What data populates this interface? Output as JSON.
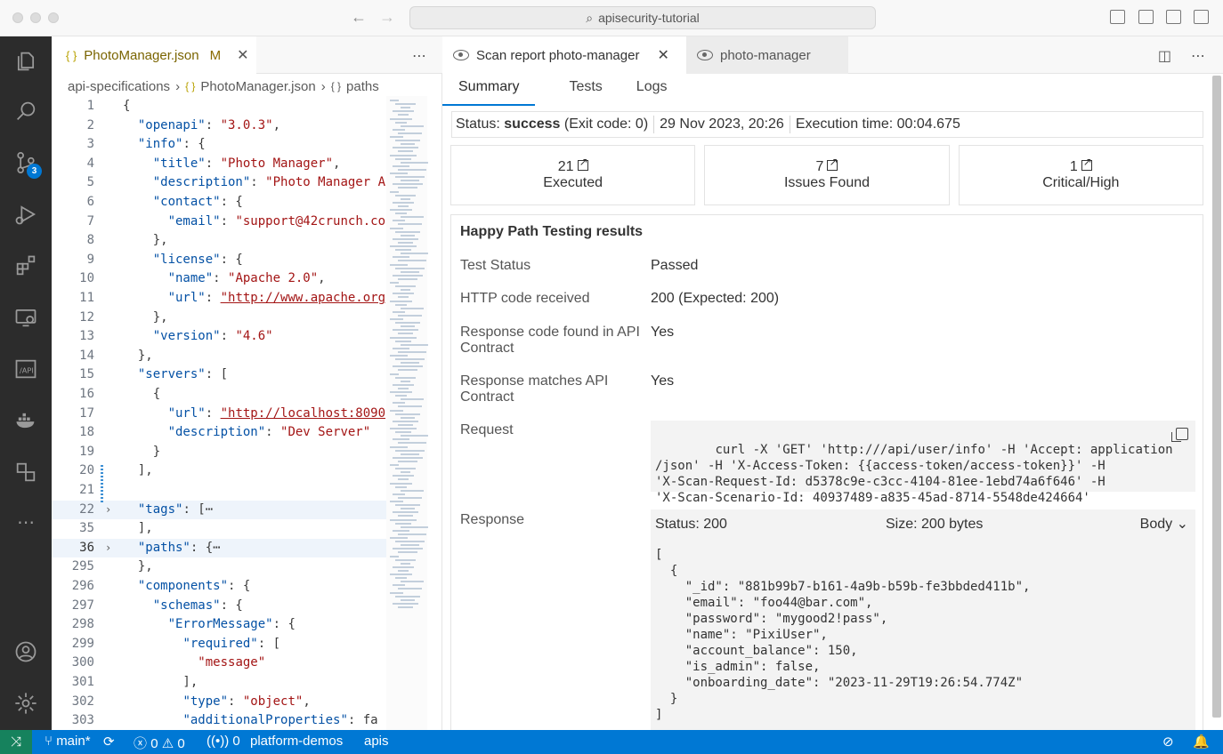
{
  "titlebar": {
    "search_text": "apisecurity-tutorial"
  },
  "activitybar": {
    "scm_badge": "3"
  },
  "editor": {
    "tab": {
      "name": "PhotoManager.json",
      "modified": "M"
    },
    "breadcrumb": [
      "api-specifications",
      "PhotoManager.json",
      "paths"
    ],
    "lines": [
      {
        "n": "1",
        "t": "{"
      },
      {
        "n": "2",
        "t": "  \"openapi\": \"3.0.3\","
      },
      {
        "n": "3",
        "t": "  \"info\": {"
      },
      {
        "n": "4",
        "t": "    \"title\": \"Photo Manager\","
      },
      {
        "n": "5",
        "t": "    \"description\": \"Photo Manager A"
      },
      {
        "n": "6",
        "t": "    \"contact\": {"
      },
      {
        "n": "7",
        "t": "      \"email\": \"support@42crunch.co"
      },
      {
        "n": "8",
        "t": "    },"
      },
      {
        "n": "9",
        "t": "    \"license\": {"
      },
      {
        "n": "10",
        "t": "      \"name\": \"Apache 2.0\","
      },
      {
        "n": "11",
        "t": "      \"url\": \"http://www.apache.org"
      },
      {
        "n": "12",
        "t": "    },"
      },
      {
        "n": "13",
        "t": "    \"version\": \"4.6\""
      },
      {
        "n": "14",
        "t": "  },"
      },
      {
        "n": "15",
        "t": "  \"servers\": ["
      },
      {
        "n": "16",
        "t": "    {"
      },
      {
        "n": "17",
        "t": "      \"url\": \"http://localhost:8090"
      },
      {
        "n": "18",
        "t": "      \"description\": \"Dev Server\""
      },
      {
        "n": "19",
        "t": "    }"
      },
      {
        "n": "20",
        "t": "  ],"
      },
      {
        "n": "21",
        "t": ""
      },
      {
        "n": "22",
        "t": "  \"tags\": [⋯"
      },
      {
        "n": "35",
        "t": "  ],"
      },
      {
        "n": "36",
        "t": "  \"paths\": {⋯"
      },
      {
        "n": "295",
        "t": "  },"
      },
      {
        "n": "296",
        "t": "  \"components\": {"
      },
      {
        "n": "297",
        "t": "    \"schemas\": {"
      },
      {
        "n": "298",
        "t": "      \"ErrorMessage\": {"
      },
      {
        "n": "299",
        "t": "        \"required\": ["
      },
      {
        "n": "300",
        "t": "          \"message\""
      },
      {
        "n": "301",
        "t": "        ],"
      },
      {
        "n": "302",
        "t": "        \"type\": \"object\","
      },
      {
        "n": "303",
        "t": "        \"additionalProperties\": fa"
      }
    ]
  },
  "panel": {
    "tab_active": "Scan report photo-manager",
    "tab_inactive": "photo-manager",
    "subtabs": [
      "Summary",
      "Tests",
      "Logs"
    ],
    "status": {
      "label": "Status:",
      "value": "success",
      "exit": "(Exit code: 0)",
      "date": "29 Nov 2023, 20:26",
      "exec": "Execution time: 00:04.675"
    },
    "stats": [
      {
        "num": "21",
        "label": "Executed"
      },
      {
        "num": "7",
        "label": "Issues Found"
      },
      {
        "num": "1",
        "label": "Critical/High"
      }
    ],
    "results_title": "Happy Path Testing results",
    "rows": [
      {
        "label": "Test Status",
        "value": "Passed"
      },
      {
        "label": "HTTP code received",
        "value": "200 (Expected: 200)"
      },
      {
        "label": "Response code found in API Contract",
        "value": "Yes"
      },
      {
        "label": "Response matches API Contract",
        "value": "Yes"
      }
    ],
    "request_label": "Request",
    "request_text": "curl -X 'GET' 'http:///api/user/info' -H 'Accept: application\n/json' -H 'X-Access-Token: {{access-token/access-token}}' -H\n'X-Scan-Request-Id: d5378c9e-c3cc-4104-81ee-1ebd74a6f646' -H\n'X-Scan-Scenario-Id: 40937489-a835-45ad-8714-5548de424664'",
    "response_label": "Response",
    "response_status": "Status: 200",
    "response_size": "Size: 200 bytes",
    "response_view": "Body",
    "response_body": "[\n  {\n    \"_id\": \"881b99b7-b161-4a9b-b59b-fe3bbded411b\",\n    \"email\": \"foo44@bar.com\",\n    \"password\": \"mygood2!pass\",\n    \"name\": \"PixiUser\",\n    \"account_balance\": 150,\n    \"is_admin\": false,\n    \"onboarding_date\": \"2023-11-29T19:26:54.774Z\"\n  }\n]"
  },
  "statusbar": {
    "branch": "main*",
    "errors": "0",
    "warnings": "0",
    "ports": "0",
    "profile": "platform-demos",
    "folder": "apis"
  }
}
